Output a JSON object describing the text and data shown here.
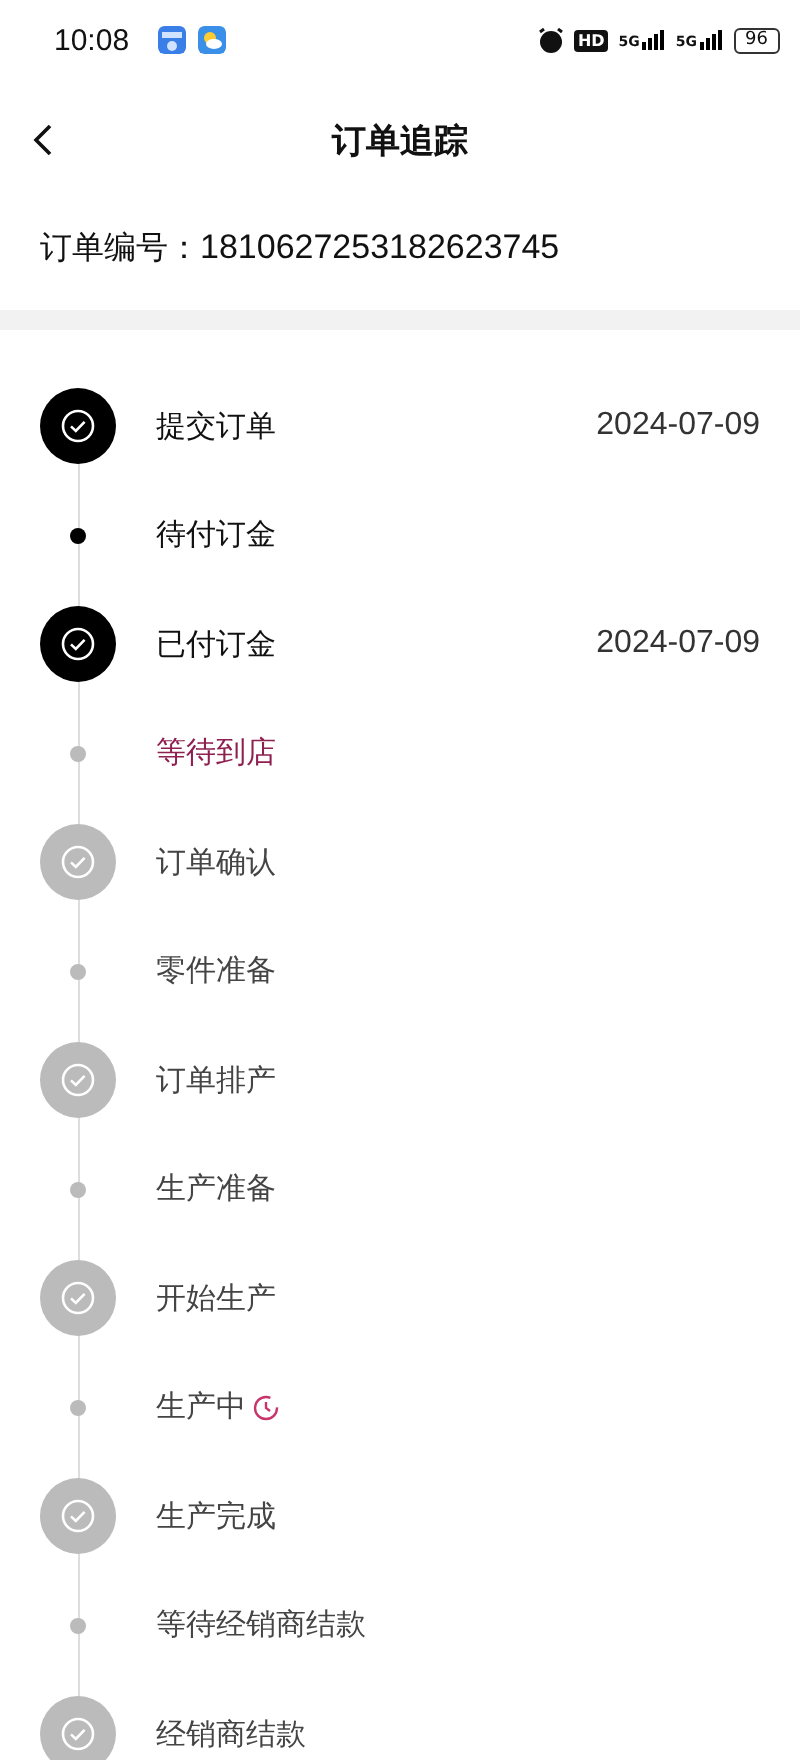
{
  "status_bar": {
    "time": "10:08",
    "hd": "HD",
    "networks": [
      "5G",
      "5G"
    ],
    "battery": "96"
  },
  "header": {
    "title": "订单追踪"
  },
  "order": {
    "label": "订单编号：",
    "number": "1810627253182623745"
  },
  "steps": [
    {
      "kind": "major",
      "done": true,
      "current": false,
      "label": "提交订单",
      "date": "2024-07-09",
      "timer": false
    },
    {
      "kind": "minor",
      "done": true,
      "current": false,
      "label": "待付订金",
      "timer": false
    },
    {
      "kind": "major",
      "done": true,
      "current": false,
      "label": "已付订金",
      "date": "2024-07-09",
      "timer": false
    },
    {
      "kind": "minor",
      "done": false,
      "current": true,
      "label": "等待到店",
      "timer": false
    },
    {
      "kind": "major",
      "done": false,
      "current": false,
      "label": "订单确认",
      "timer": false
    },
    {
      "kind": "minor",
      "done": false,
      "current": false,
      "label": "零件准备",
      "timer": false
    },
    {
      "kind": "major",
      "done": false,
      "current": false,
      "label": "订单排产",
      "timer": false
    },
    {
      "kind": "minor",
      "done": false,
      "current": false,
      "label": "生产准备",
      "timer": false
    },
    {
      "kind": "major",
      "done": false,
      "current": false,
      "label": "开始生产",
      "timer": false
    },
    {
      "kind": "minor",
      "done": false,
      "current": false,
      "label": "生产中",
      "timer": true
    },
    {
      "kind": "major",
      "done": false,
      "current": false,
      "label": "生产完成",
      "timer": false
    },
    {
      "kind": "minor",
      "done": false,
      "current": false,
      "label": "等待经销商结款",
      "timer": false
    },
    {
      "kind": "major",
      "done": false,
      "current": false,
      "label": "经销商结款",
      "timer": false
    }
  ]
}
